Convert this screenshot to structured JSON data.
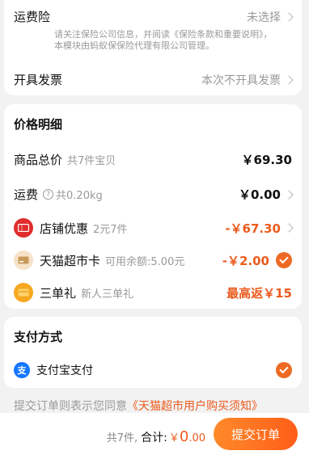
{
  "shipping_insurance": {
    "label": "运费险",
    "value": "未选择",
    "notice": "请关注保险公司信息，并阅读《保险条款和重要说明》，本模块由蚂蚁保保险代理有限公司管理。"
  },
  "invoice": {
    "label": "开具发票",
    "value": "本次不开具发票"
  },
  "price": {
    "title": "价格明细",
    "total_label": "商品总价",
    "total_sub": "共7件宝贝",
    "total_value": "￥69.30",
    "freight_label": "运费",
    "freight_sub": "共0.20kg",
    "freight_value": "￥0.00",
    "shop_discount_label": "店铺优惠",
    "shop_discount_sub": "2元7件",
    "shop_discount_value": "-￥67.30",
    "card_label": "天猫超市卡",
    "card_sub": "可用余额:5.00元",
    "card_value": "-￥2.00",
    "gift_label": "三单礼",
    "gift_sub": "新人三单礼",
    "gift_value": "最高返￥15"
  },
  "payment": {
    "title": "支付方式",
    "method": "支付宝支付",
    "alipay_glyph": "支"
  },
  "agreement": {
    "prefix": "提交订单则表示您同意",
    "link": "《天猫超市用户购买须知》"
  },
  "footer": {
    "count": "共7件,",
    "total_label": "合计:",
    "currency": "￥",
    "amount_int": "0",
    "amount_dec": ".00",
    "submit": "提交订单"
  },
  "colors": {
    "accent": "#ec5b1e",
    "button_start": "#ff8a2a",
    "button_end": "#ff5d18"
  }
}
